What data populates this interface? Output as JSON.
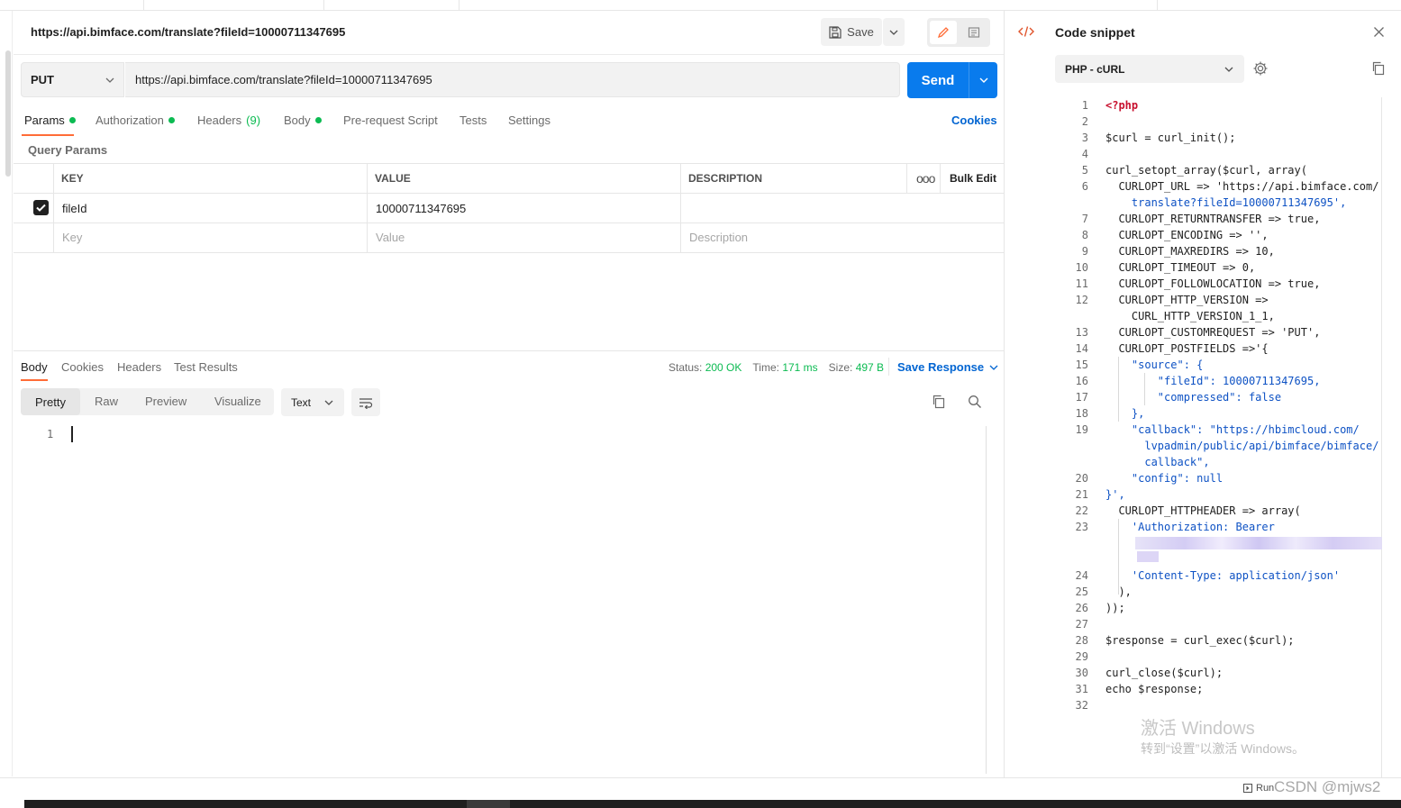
{
  "request": {
    "title": "https://api.bimface.com/translate?fileId=10000711347695",
    "save_label": "Save",
    "method": "PUT",
    "url": "https://api.bimface.com/translate?fileId=10000711347695",
    "send_label": "Send"
  },
  "req_tabs": [
    {
      "label": "Params",
      "dot": true
    },
    {
      "label": "Authorization",
      "dot": true
    },
    {
      "label": "Headers",
      "count": "(9)"
    },
    {
      "label": "Body",
      "dot": true
    },
    {
      "label": "Pre-request Script"
    },
    {
      "label": "Tests"
    },
    {
      "label": "Settings"
    }
  ],
  "cookies_label": "Cookies",
  "query_params": {
    "label": "Query Params",
    "headers": {
      "key": "KEY",
      "value": "VALUE",
      "description": "DESCRIPTION",
      "bulk_edit": "Bulk Edit"
    },
    "rows": [
      {
        "checked": true,
        "key": "fileId",
        "value": "10000711347695",
        "description": ""
      }
    ],
    "placeholder": {
      "key": "Key",
      "value": "Value",
      "description": "Description"
    }
  },
  "response": {
    "tabs": [
      "Body",
      "Cookies",
      "Headers",
      "Test Results"
    ],
    "status_label": "Status:",
    "status_value": "200 OK",
    "time_label": "Time:",
    "time_value": "171 ms",
    "size_label": "Size:",
    "size_value": "497 B",
    "save_response": "Save Response",
    "view_modes": [
      "Pretty",
      "Raw",
      "Preview",
      "Visualize"
    ],
    "format": "Text",
    "line_numbers": [
      "1"
    ]
  },
  "snippet": {
    "title": "Code snippet",
    "language": "PHP - cURL",
    "lines": [
      {
        "n": "1",
        "text": "<?php"
      },
      {
        "n": "2",
        "text": ""
      },
      {
        "n": "3",
        "text": "$curl = curl_init();"
      },
      {
        "n": "4",
        "text": ""
      },
      {
        "n": "5",
        "text": "curl_setopt_array($curl, array("
      },
      {
        "n": "6",
        "text": "  CURLOPT_URL => 'https://api.bimface.com/"
      },
      {
        "n": "",
        "text": "    translate?fileId=10000711347695',"
      },
      {
        "n": "7",
        "text": "  CURLOPT_RETURNTRANSFER => true,"
      },
      {
        "n": "8",
        "text": "  CURLOPT_ENCODING => '',"
      },
      {
        "n": "9",
        "text": "  CURLOPT_MAXREDIRS => 10,"
      },
      {
        "n": "10",
        "text": "  CURLOPT_TIMEOUT => 0,"
      },
      {
        "n": "11",
        "text": "  CURLOPT_FOLLOWLOCATION => true,"
      },
      {
        "n": "12",
        "text": "  CURLOPT_HTTP_VERSION =>"
      },
      {
        "n": "",
        "text": "    CURL_HTTP_VERSION_1_1,"
      },
      {
        "n": "13",
        "text": "  CURLOPT_CUSTOMREQUEST => 'PUT',"
      },
      {
        "n": "14",
        "text": "  CURLOPT_POSTFIELDS =>'{"
      },
      {
        "n": "15",
        "text": "    \"source\": {"
      },
      {
        "n": "16",
        "text": "        \"fileId\": 10000711347695,"
      },
      {
        "n": "17",
        "text": "        \"compressed\": false"
      },
      {
        "n": "18",
        "text": "    },"
      },
      {
        "n": "19",
        "text": "    \"callback\": \"https://hbimcloud.com/"
      },
      {
        "n": "",
        "text": "      lvpadmin/public/api/bimface/bimface/"
      },
      {
        "n": "",
        "text": "      callback\","
      },
      {
        "n": "20",
        "text": "    \"config\": null"
      },
      {
        "n": "21",
        "text": "}',"
      },
      {
        "n": "22",
        "text": "  CURLOPT_HTTPHEADER => array("
      },
      {
        "n": "23",
        "text": "    'Authorization: Bearer"
      },
      {
        "n": "",
        "text": ""
      },
      {
        "n": "",
        "text": ""
      },
      {
        "n": "24",
        "text": "    'Content-Type: application/json'"
      },
      {
        "n": "25",
        "text": "  ),"
      },
      {
        "n": "26",
        "text": "));"
      },
      {
        "n": "27",
        "text": ""
      },
      {
        "n": "28",
        "text": "$response = curl_exec($curl);"
      },
      {
        "n": "29",
        "text": ""
      },
      {
        "n": "30",
        "text": "curl_close($curl);"
      },
      {
        "n": "31",
        "text": "echo $response;"
      },
      {
        "n": "32",
        "text": ""
      }
    ]
  },
  "watermark": {
    "title": "激活 Windows",
    "subtitle": "转到“设置”以激活 Windows。"
  },
  "footer": {
    "runner": "Run",
    "csdn": "CSDN @mjws2"
  }
}
